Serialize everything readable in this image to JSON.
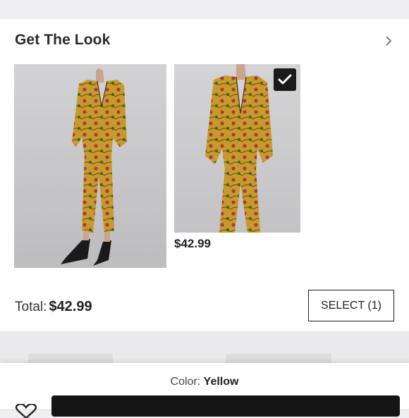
{
  "section": {
    "title": "Get The Look"
  },
  "products": [
    {
      "price": ""
    },
    {
      "price": "$42.99",
      "selected": true
    }
  ],
  "footer": {
    "total_label": "Total:",
    "total_value": "$42.99",
    "select_label": "SELECT (1)"
  },
  "bottom_sheet": {
    "color_label": "Color:",
    "color_value": "Yellow"
  },
  "colors": {
    "suit_gold": "#c89a2a",
    "background": "#efeff1",
    "button_dark": "#151515"
  },
  "icons": {
    "chevron": "chevron-right-icon",
    "check": "checkmark-icon",
    "heart": "heart-icon"
  }
}
